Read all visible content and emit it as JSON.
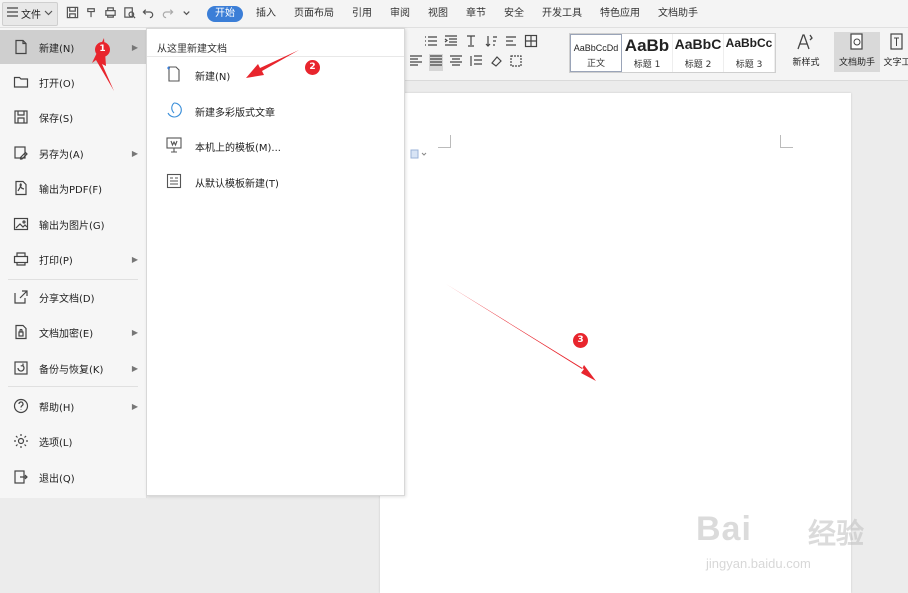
{
  "menubar": {
    "file_label": "文件",
    "tabs": [
      "开始",
      "插入",
      "页面布局",
      "引用",
      "审阅",
      "视图",
      "章节",
      "安全",
      "开发工具",
      "特色应用",
      "文档助手"
    ],
    "active_tab": "开始"
  },
  "ribbon": {
    "styles": [
      {
        "sample": "AaBbCcDd",
        "name": "正文"
      },
      {
        "sample": "AaBb",
        "name": "标题 1"
      },
      {
        "sample": "AaBbC",
        "name": "标题 2"
      },
      {
        "sample": "AaBbCc",
        "name": "标题 3"
      }
    ],
    "new_style": "新样式",
    "doc_helper": "文档助手",
    "text_tool": "文字工"
  },
  "file_menu": {
    "items": [
      {
        "label": "新建(N)",
        "icon": "new-doc-icon",
        "submenu": true
      },
      {
        "label": "打开(O)",
        "icon": "folder-icon",
        "submenu": false
      },
      {
        "label": "保存(S)",
        "icon": "save-icon",
        "submenu": false
      },
      {
        "label": "另存为(A)",
        "icon": "save-as-icon",
        "submenu": true
      },
      {
        "label": "输出为PDF(F)",
        "icon": "pdf-icon",
        "submenu": false
      },
      {
        "label": "输出为图片(G)",
        "icon": "image-icon",
        "submenu": false
      },
      {
        "label": "打印(P)",
        "icon": "printer-icon",
        "submenu": true
      },
      {
        "label": "分享文档(D)",
        "icon": "share-icon",
        "submenu": false
      },
      {
        "label": "文档加密(E)",
        "icon": "encrypt-icon",
        "submenu": true
      },
      {
        "label": "备份与恢复(K)",
        "icon": "backup-icon",
        "submenu": true
      },
      {
        "label": "帮助(H)",
        "icon": "help-icon",
        "submenu": true
      },
      {
        "label": "选项(L)",
        "icon": "gear-icon",
        "submenu": false
      },
      {
        "label": "退出(Q)",
        "icon": "exit-icon",
        "submenu": false
      }
    ]
  },
  "new_submenu": {
    "heading": "从这里新建文档",
    "items": [
      {
        "label": "新建(N)",
        "icon": "blank-doc-icon"
      },
      {
        "label": "新建多彩版式文章",
        "icon": "colorful-article-icon"
      },
      {
        "label": "本机上的模板(M)...",
        "icon": "local-template-icon"
      },
      {
        "label": "从默认模板新建(T)",
        "icon": "default-template-icon"
      }
    ]
  },
  "annotations": {
    "b1": "1",
    "b2": "2",
    "b3": "3",
    "arrow_color": "#e8252d"
  },
  "watermark": {
    "brand": "Bai",
    "jingyan": "经验",
    "url": "jingyan.baidu.com"
  },
  "colors": {
    "accent": "#3b7ed7",
    "highlight": "#cfcfcf"
  }
}
